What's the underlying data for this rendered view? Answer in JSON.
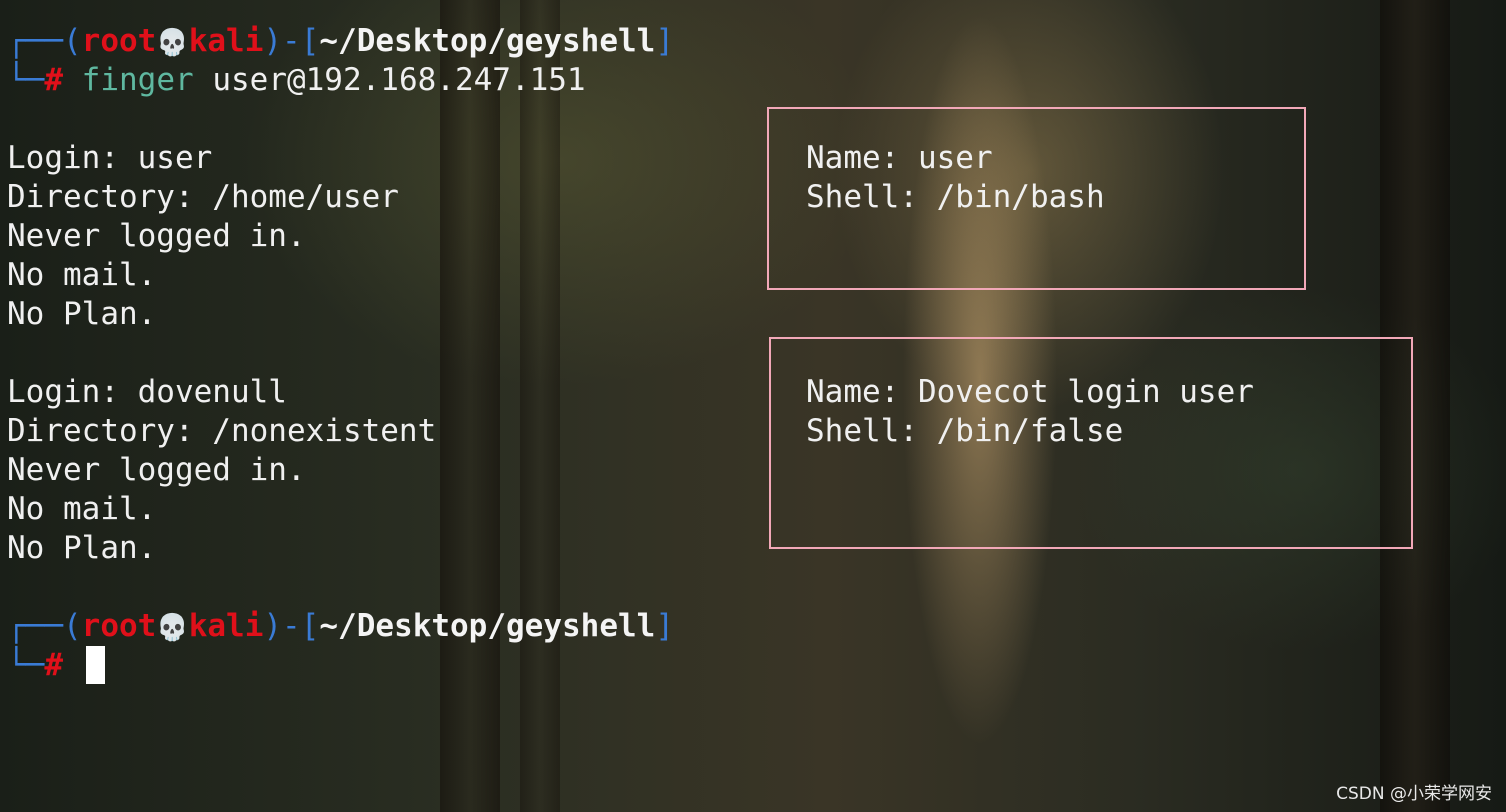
{
  "prompt1": {
    "corner_top": "┌──",
    "corner_bottom": "└─",
    "open_paren": "(",
    "user": "root",
    "skull": "💀",
    "host": "kali",
    "close_paren": ")",
    "sep": "-",
    "open_bracket": "[",
    "path": "~/Desktop/geyshell",
    "close_bracket": "]",
    "symbol": "#",
    "command": "finger",
    "argument": "user@192.168.247.151"
  },
  "output": {
    "entry1": {
      "login": "Login: user",
      "name": "Name: user",
      "directory": "Directory: /home/user",
      "shell": "Shell: /bin/bash",
      "logged": "Never logged in.",
      "mail": "No mail.",
      "plan": "No Plan."
    },
    "entry2": {
      "login": "Login: dovenull",
      "name": "Name: Dovecot login user",
      "directory": "Directory: /nonexistent",
      "shell": "Shell: /bin/false",
      "logged": "Never logged in.",
      "mail": "No mail.",
      "plan": "No Plan."
    }
  },
  "prompt2": {
    "corner_top": "┌──",
    "corner_bottom": "└─",
    "open_paren": "(",
    "user": "root",
    "skull": "💀",
    "host": "kali",
    "close_paren": ")",
    "sep": "-",
    "open_bracket": "[",
    "path": "~/Desktop/geyshell",
    "close_bracket": "]",
    "symbol": "#"
  },
  "watermark": "CSDN @小荣学网安",
  "colors": {
    "prompt_frame": "#3a7bd5",
    "prompt_user": "#e0101a",
    "command": "#5fb8a0",
    "highlight_box": "#f2a8b8"
  }
}
